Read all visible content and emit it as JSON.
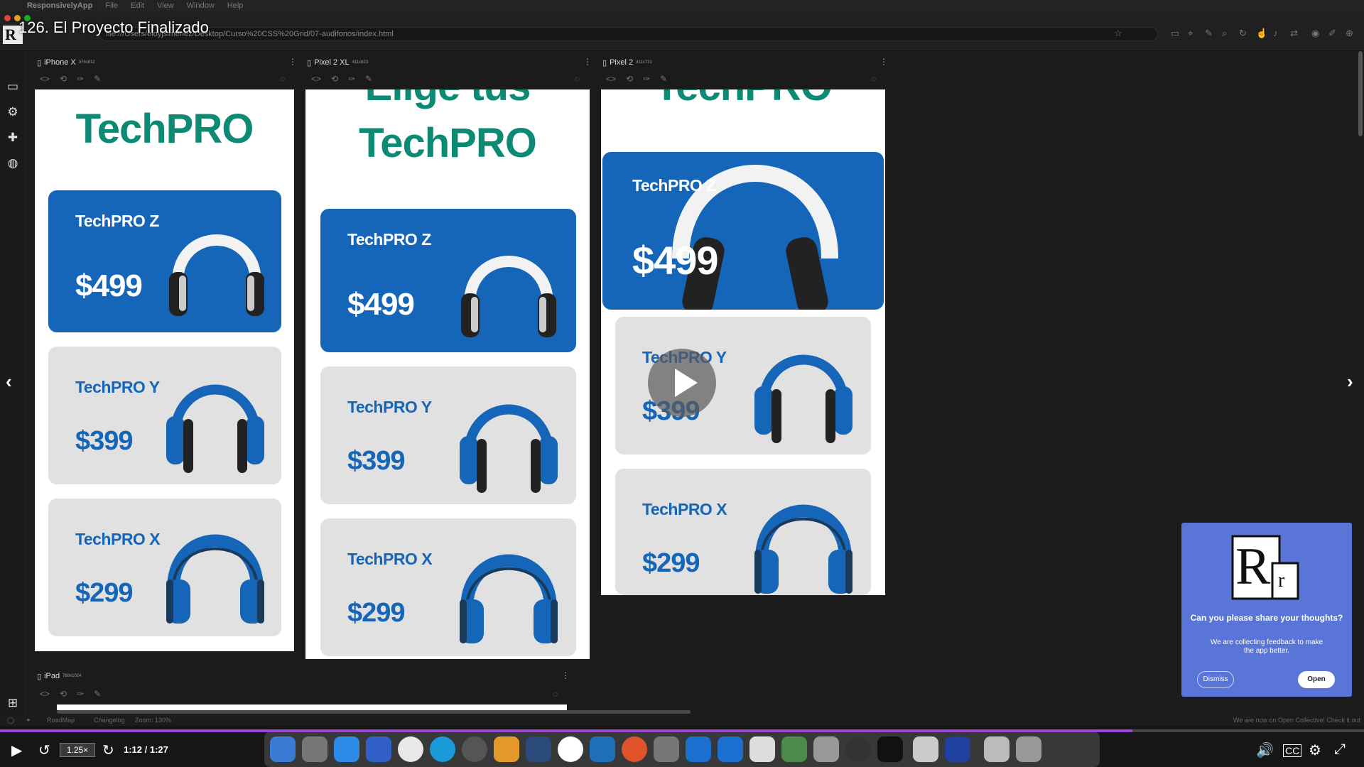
{
  "menubar": {
    "app": "ResponsivelyApp",
    "items": [
      "File",
      "Edit",
      "View",
      "Window",
      "Help"
    ]
  },
  "video": {
    "title": "126. El Proyecto Finalizado",
    "time": "1:12 / 1:27",
    "speed": "1.25×",
    "progress": 0.83
  },
  "app": {
    "url": "file:///Users/eloyjsimenez/Desktop/Curso%20CSS%20Grid/07-audifonos/index.html",
    "logo_letter": "R"
  },
  "devices": [
    {
      "name": "iPhone X",
      "res": "375x812"
    },
    {
      "name": "Pixel 2 XL",
      "res": "411x823"
    },
    {
      "name": "Pixel 2",
      "res": "411x731"
    },
    {
      "name": "iPad",
      "res": "768x1024"
    }
  ],
  "site": {
    "brand": "TechPRO",
    "heading_partial": "Elige tus",
    "products": [
      {
        "name": "TechPRO Z",
        "price": "$499"
      },
      {
        "name": "TechPRO Y",
        "price": "$399"
      },
      {
        "name": "TechPRO X",
        "price": "$299"
      }
    ],
    "colors": {
      "blue": "#1565b8",
      "green": "#0c8a73",
      "gray": "#e1e1e1"
    }
  },
  "feedback": {
    "title": "Can you please share your thoughts?",
    "text": "We are collecting feedback to make the app better.",
    "dismiss": "Dismiss",
    "open": "Open",
    "logo_big": "R",
    "logo_small": "r"
  },
  "statusbar": {
    "roadmap": "RoadMap",
    "changelog": "Changelog",
    "zoom": "Zoom: 130%",
    "notice": "We are now on Open Collective! Check it out"
  }
}
